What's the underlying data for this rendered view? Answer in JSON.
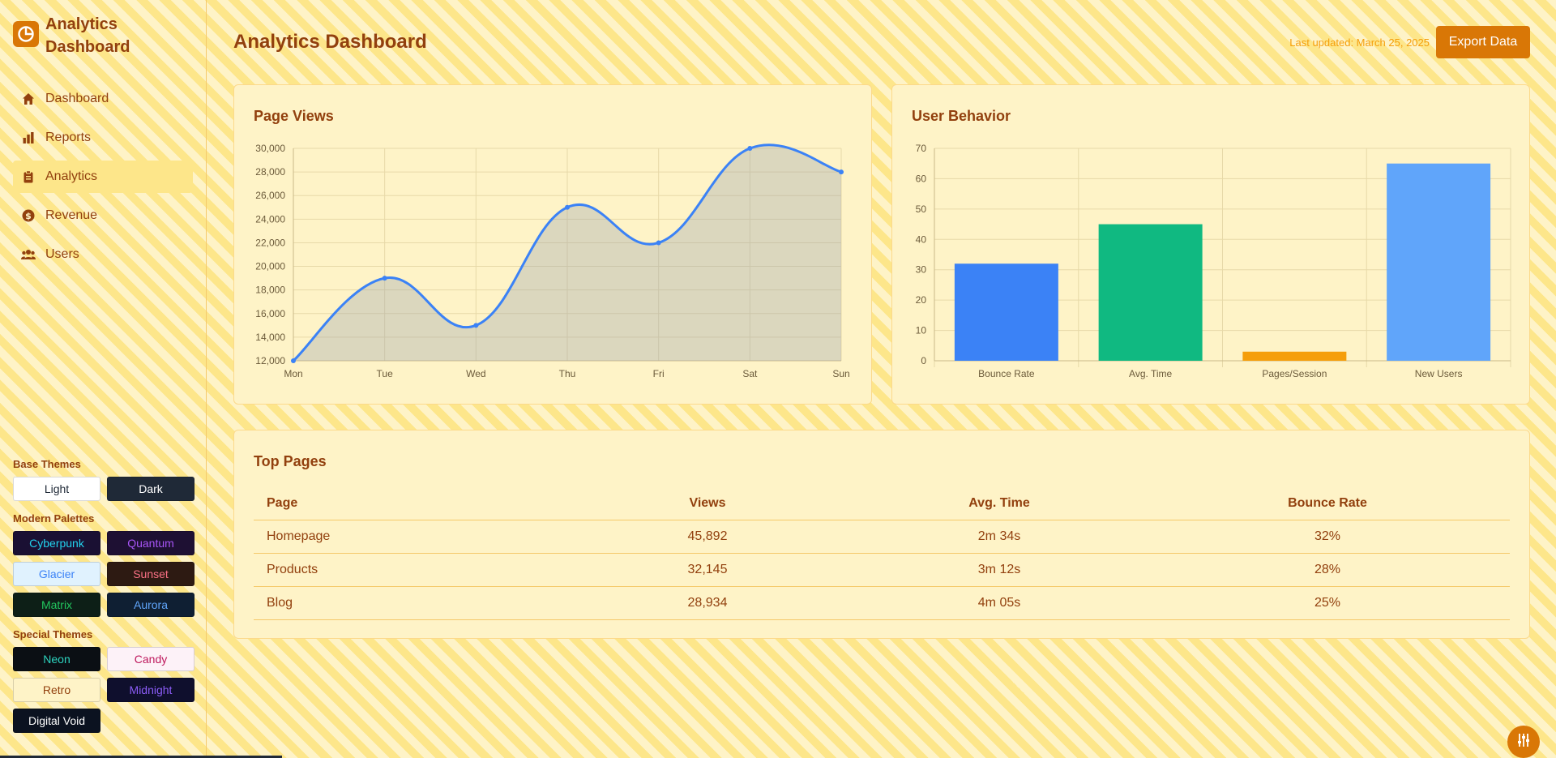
{
  "brand": {
    "title": "Analytics Dashboard",
    "icon": "pie-chart-icon"
  },
  "nav": [
    {
      "label": "Dashboard",
      "icon": "home-icon",
      "active": false
    },
    {
      "label": "Reports",
      "icon": "bar-chart-icon",
      "active": false
    },
    {
      "label": "Analytics",
      "icon": "clipboard-icon",
      "active": true
    },
    {
      "label": "Revenue",
      "icon": "dollar-circle-icon",
      "active": false
    },
    {
      "label": "Users",
      "icon": "users-icon",
      "active": false
    }
  ],
  "themes": {
    "base_heading": "Base Themes",
    "base": [
      {
        "label": "Light",
        "bg": "#ffffff",
        "fg": "#1f2937"
      },
      {
        "label": "Dark",
        "bg": "#1f2937",
        "fg": "#ffffff"
      }
    ],
    "modern_heading": "Modern Palettes",
    "modern": [
      {
        "label": "Cyberpunk",
        "bg": "#1a1033",
        "fg": "#22d3ee"
      },
      {
        "label": "Quantum",
        "bg": "#1e1033",
        "fg": "#a855f7"
      },
      {
        "label": "Glacier",
        "bg": "#e0f2fe",
        "fg": "#3b82f6"
      },
      {
        "label": "Sunset",
        "bg": "#2d1a12",
        "fg": "#fb7185"
      },
      {
        "label": "Matrix",
        "bg": "#0d1f17",
        "fg": "#22c55e"
      },
      {
        "label": "Aurora",
        "bg": "#0f1f33",
        "fg": "#60a5fa"
      }
    ],
    "special_heading": "Special Themes",
    "special": [
      {
        "label": "Neon",
        "bg": "#0b0f14",
        "fg": "#2dd4bf"
      },
      {
        "label": "Candy",
        "bg": "#fdf2f8",
        "fg": "#be185d"
      },
      {
        "label": "Retro",
        "bg": "#fef3c7",
        "fg": "#92400e"
      },
      {
        "label": "Midnight",
        "bg": "#0f0f2d",
        "fg": "#8b5cf6"
      },
      {
        "label": "Digital Void",
        "bg": "#0b1220",
        "fg": "#ffffff"
      }
    ]
  },
  "header": {
    "title": "Analytics Dashboard",
    "last_updated": "Last updated: March 25, 2025",
    "export_label": "Export Data"
  },
  "colors": {
    "accent": "#d97706",
    "line": "#3b82f6",
    "text": "#92400e"
  },
  "chart_data": [
    {
      "type": "area",
      "title": "Page Views",
      "categories": [
        "Mon",
        "Tue",
        "Wed",
        "Thu",
        "Fri",
        "Sat",
        "Sun"
      ],
      "values": [
        12000,
        19000,
        15000,
        25000,
        22000,
        30000,
        28000
      ],
      "ylim": [
        12000,
        30000
      ],
      "yticks": [
        "12,000",
        "14,000",
        "16,000",
        "18,000",
        "20,000",
        "22,000",
        "24,000",
        "26,000",
        "28,000",
        "30,000"
      ],
      "grid": true,
      "legend": "none"
    },
    {
      "type": "bar",
      "title": "User Behavior",
      "categories": [
        "Bounce Rate",
        "Avg. Time",
        "Pages/Session",
        "New Users"
      ],
      "values": [
        32,
        45,
        3,
        65
      ],
      "colors": [
        "#3b82f6",
        "#10b981",
        "#f59e0b",
        "#60a5fa"
      ],
      "ylim": [
        0,
        70
      ],
      "yticks": [
        "0",
        "10",
        "20",
        "30",
        "40",
        "50",
        "60",
        "70"
      ],
      "grid": true,
      "legend": "none"
    }
  ],
  "top_pages": {
    "title": "Top Pages",
    "columns": [
      "Page",
      "Views",
      "Avg. Time",
      "Bounce Rate"
    ],
    "rows": [
      [
        "Homepage",
        "45,892",
        "2m 34s",
        "32%"
      ],
      [
        "Products",
        "32,145",
        "3m 12s",
        "28%"
      ],
      [
        "Blog",
        "28,934",
        "4m 05s",
        "25%"
      ]
    ]
  },
  "fab": {
    "icon": "sliders-icon"
  }
}
